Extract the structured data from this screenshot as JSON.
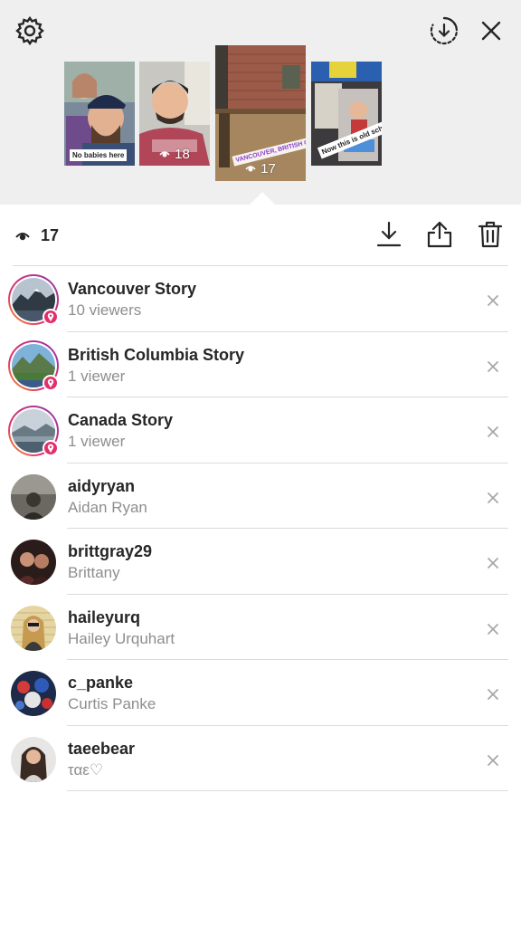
{
  "icons": {
    "settings": "gear-icon",
    "archive_download": "circle-download-icon",
    "close": "close-icon",
    "eye": "eye-icon",
    "download": "download-icon",
    "share": "share-icon",
    "delete": "trash-icon",
    "remove": "x-icon",
    "location": "location-pin-icon"
  },
  "stories": [
    {
      "caption": "No babies here",
      "views": ""
    },
    {
      "caption": "",
      "views": "18"
    },
    {
      "caption": "VANCOUVER, BRITISH COLUMBIA",
      "views": "17"
    },
    {
      "caption": "Now this is old school",
      "views": ""
    }
  ],
  "stats": {
    "view_count": "17"
  },
  "viewers": [
    {
      "title": "Vancouver Story",
      "subtitle": "10 viewers",
      "location_story": true
    },
    {
      "title": "British Columbia Story",
      "subtitle": "1 viewer",
      "location_story": true
    },
    {
      "title": "Canada Story",
      "subtitle": "1 viewer",
      "location_story": true
    },
    {
      "title": "aidyryan",
      "subtitle": "Aidan Ryan",
      "location_story": false
    },
    {
      "title": "brittgray29",
      "subtitle": "Brittany",
      "location_story": false
    },
    {
      "title": "haileyurq",
      "subtitle": "Hailey Urquhart",
      "location_story": false
    },
    {
      "title": "c_panke",
      "subtitle": "Curtis Panke",
      "location_story": false
    },
    {
      "title": "taeebear",
      "subtitle": "ταε♡",
      "location_story": false
    }
  ],
  "colors": {
    "story_ring_start": "#f5a623",
    "story_ring_end": "#833ab4",
    "location_badge": "#e1306c",
    "subtitle_gray": "#8e8e8e",
    "divider": "#dbdbdb"
  }
}
